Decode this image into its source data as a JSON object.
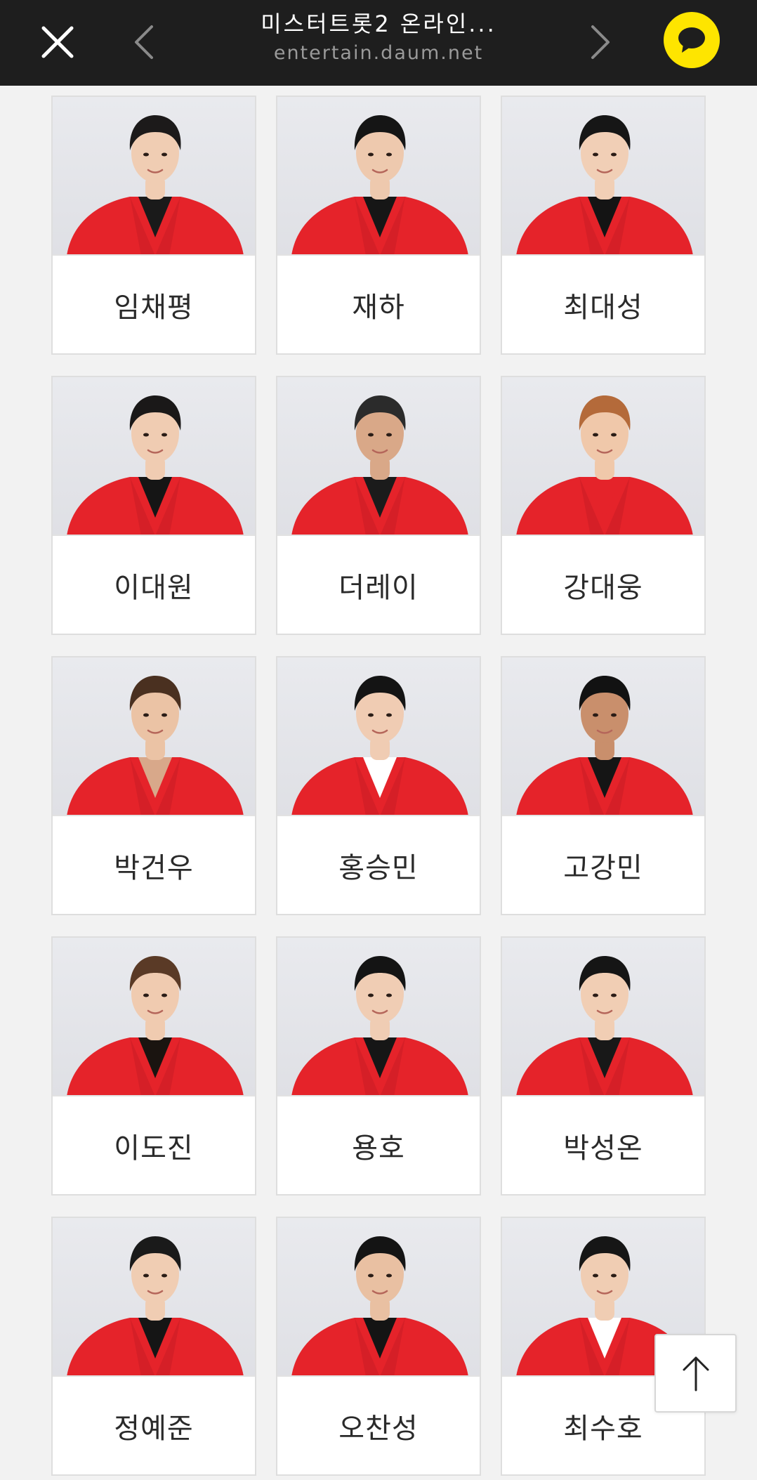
{
  "topbar": {
    "title": "미스터트롯2 온라인...",
    "domain": "entertain.daum.net"
  },
  "icons": {
    "close": "close-icon",
    "prev": "chevron-left-icon",
    "next": "chevron-right-icon",
    "share": "kakaotalk-icon",
    "scroll_top": "arrow-up-icon"
  },
  "colors": {
    "topbar_bg": "#1e1e1e",
    "kakao_yellow": "#fee500",
    "jacket_red": "#e5232a"
  },
  "contestants": [
    {
      "name": "임채평",
      "hair": "#1c1a1a",
      "shirt": "#1a1a1a",
      "skin": "#f0cdb3"
    },
    {
      "name": "재하",
      "hair": "#151515",
      "shirt": "#161616",
      "skin": "#eec9ae"
    },
    {
      "name": "최대성",
      "hair": "#161616",
      "shirt": "#141414",
      "skin": "#f1cfb6"
    },
    {
      "name": "이대원",
      "hair": "#1a1818",
      "shirt": "#151515",
      "skin": "#f0ccb2"
    },
    {
      "name": "더레이",
      "hair": "#2b2b2b",
      "shirt": "#1b1b1b",
      "skin": "#d9a888"
    },
    {
      "name": "강대웅",
      "hair": "#b46a3a",
      "shirt": "#e5232a",
      "skin": "#f0c8aa"
    },
    {
      "name": "박건우",
      "hair": "#4a3020",
      "shirt": "#d8a88a",
      "skin": "#ebc3a5"
    },
    {
      "name": "홍승민",
      "hair": "#141414",
      "shirt": "#ffffff",
      "skin": "#f0ccb3"
    },
    {
      "name": "고강민",
      "hair": "#121212",
      "shirt": "#151515",
      "skin": "#c98f6c"
    },
    {
      "name": "이도진",
      "hair": "#5a3a26",
      "shirt": "#1a1410",
      "skin": "#f0cbb0"
    },
    {
      "name": "용호",
      "hair": "#141414",
      "shirt": "#161616",
      "skin": "#f0cdb4"
    },
    {
      "name": "박성온",
      "hair": "#151515",
      "shirt": "#181818",
      "skin": "#f1ceb4"
    },
    {
      "name": "정예준",
      "hair": "#1a1a1a",
      "shirt": "#151515",
      "skin": "#f0cdb3"
    },
    {
      "name": "오찬성",
      "hair": "#141414",
      "shirt": "#141414",
      "skin": "#e9c0a2"
    },
    {
      "name": "최수호",
      "hair": "#161616",
      "shirt": "#ffffff",
      "skin": "#f0cdb3"
    }
  ]
}
